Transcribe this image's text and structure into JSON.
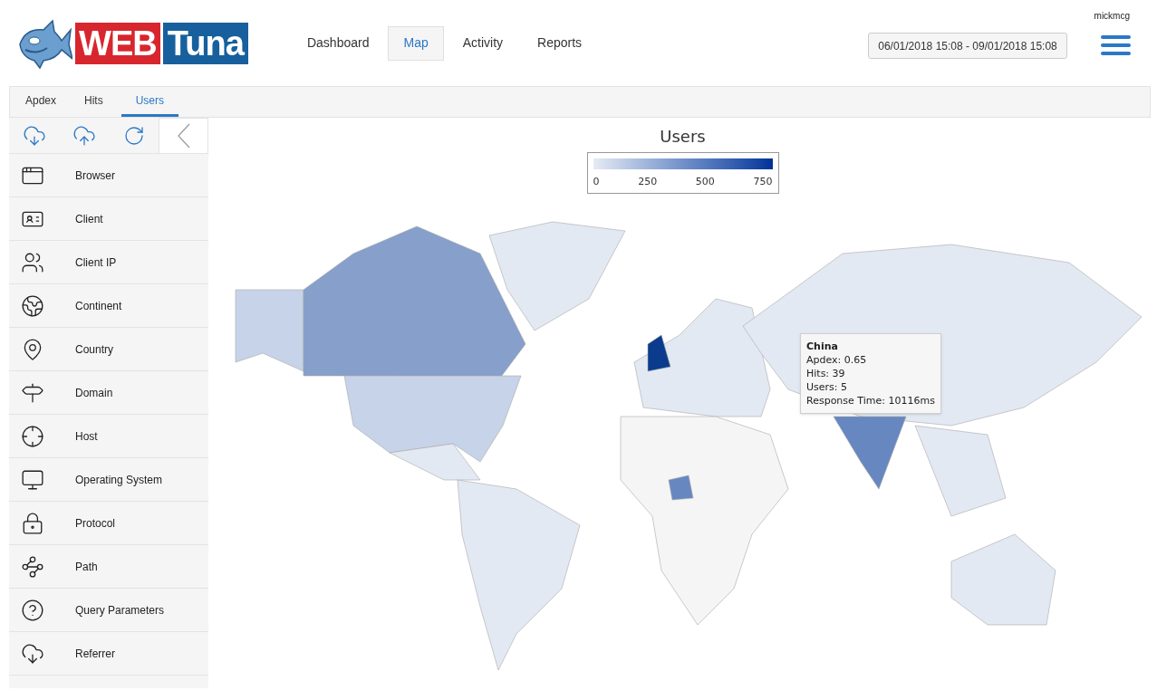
{
  "header": {
    "logo": {
      "word_1": "WEB",
      "word_2": "Tuna"
    },
    "nav": [
      {
        "label": "Dashboard",
        "selected": false
      },
      {
        "label": "Map",
        "selected": true
      },
      {
        "label": "Activity",
        "selected": false
      },
      {
        "label": "Reports",
        "selected": false
      }
    ],
    "date_range": "06/01/2018 15:08 - 09/01/2018 15:08",
    "username": "mickmcg"
  },
  "tabs": [
    {
      "label": "Apdex",
      "selected": false
    },
    {
      "label": "Hits",
      "selected": false
    },
    {
      "label": "Users",
      "selected": true
    }
  ],
  "sidebar": {
    "items": [
      {
        "label": "Browser"
      },
      {
        "label": "Client"
      },
      {
        "label": "Client IP"
      },
      {
        "label": "Continent"
      },
      {
        "label": "Country"
      },
      {
        "label": "Domain"
      },
      {
        "label": "Host"
      },
      {
        "label": "Operating System"
      },
      {
        "label": "Protocol"
      },
      {
        "label": "Path"
      },
      {
        "label": "Query Parameters"
      },
      {
        "label": "Referrer"
      }
    ]
  },
  "map": {
    "title": "Users",
    "legend_ticks": [
      "0",
      "250",
      "500",
      "750"
    ],
    "tooltip": {
      "title": "China",
      "lines": [
        "Apdex: 0.65",
        "Hits: 39",
        "Users: 5",
        "Response Time: 10116ms"
      ]
    }
  }
}
